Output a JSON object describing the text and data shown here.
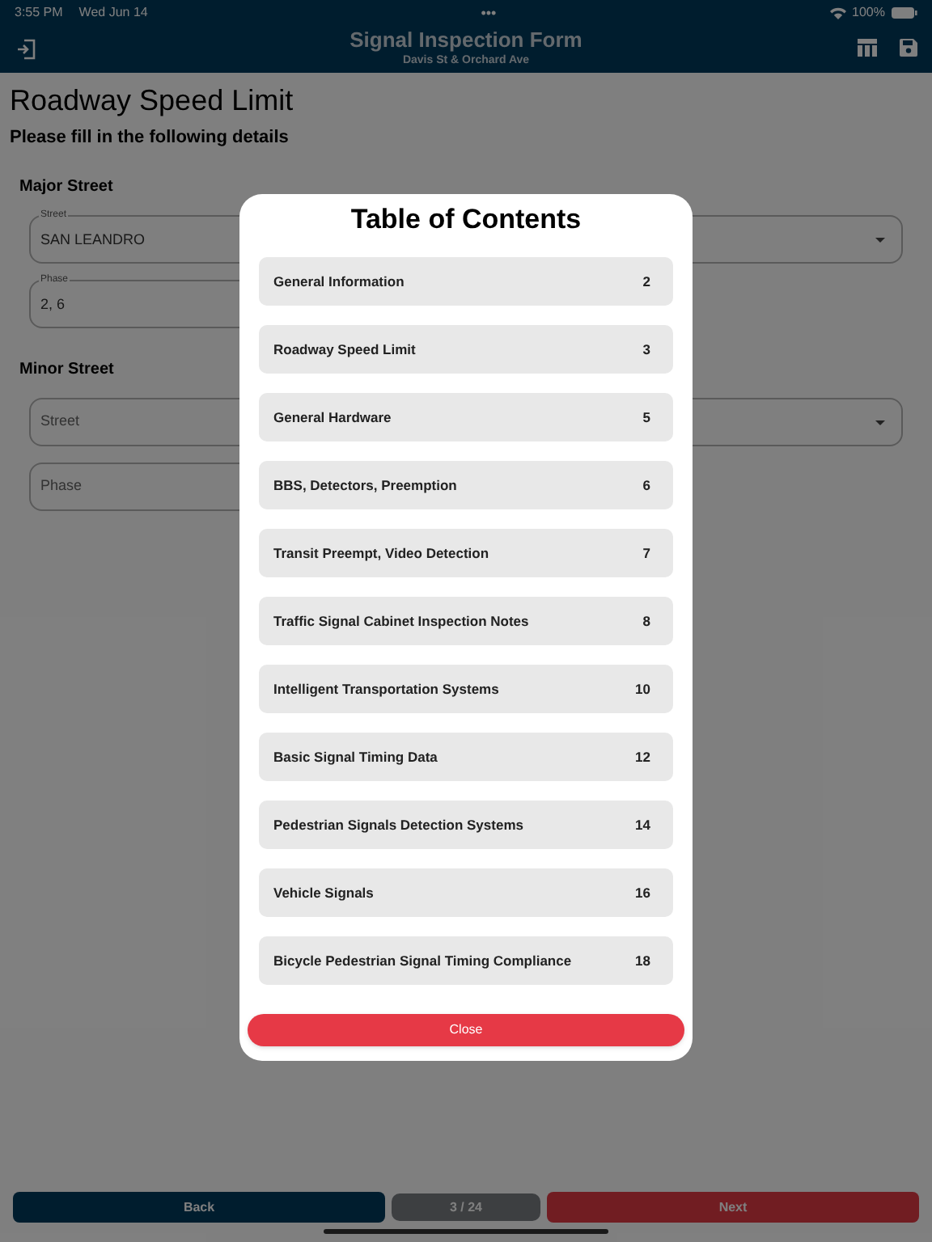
{
  "status_bar": {
    "time": "3:55 PM",
    "date": "Wed Jun 14",
    "dots": "•••",
    "battery": "100%"
  },
  "header": {
    "title": "Signal Inspection Form",
    "subtitle": "Davis St & Orchard Ave"
  },
  "page": {
    "title": "Roadway Speed Limit",
    "instructions": "Please fill in the following details",
    "sections": [
      {
        "heading": "Major Street",
        "fields": [
          {
            "kind": "dropdown",
            "label": "Street",
            "value": "SAN LEANDRO"
          },
          {
            "kind": "text",
            "label": "Phase",
            "value": "2, 6"
          }
        ]
      },
      {
        "heading": "Minor Street",
        "fields": [
          {
            "kind": "dropdown",
            "placeholder": "Street"
          },
          {
            "kind": "text",
            "placeholder": "Phase"
          }
        ]
      }
    ]
  },
  "footer": {
    "back": "Back",
    "page_indicator": "3 / 24",
    "next": "Next"
  },
  "modal": {
    "title": "Table of Contents",
    "close": "Close",
    "items": [
      {
        "label": "General Information",
        "page": "2"
      },
      {
        "label": "Roadway Speed Limit",
        "page": "3"
      },
      {
        "label": "General Hardware",
        "page": "5"
      },
      {
        "label": "BBS, Detectors, Preemption",
        "page": "6"
      },
      {
        "label": "Transit Preempt, Video Detection",
        "page": "7"
      },
      {
        "label": "Traffic Signal Cabinet Inspection Notes",
        "page": "8"
      },
      {
        "label": "Intelligent Transportation Systems",
        "page": "10"
      },
      {
        "label": "Basic Signal Timing Data",
        "page": "12"
      },
      {
        "label": "Pedestrian Signals Detection Systems",
        "page": "14"
      },
      {
        "label": "Vehicle Signals",
        "page": "16"
      },
      {
        "label": "Bicycle Pedestrian Signal Timing Compliance",
        "page": "18"
      }
    ]
  }
}
